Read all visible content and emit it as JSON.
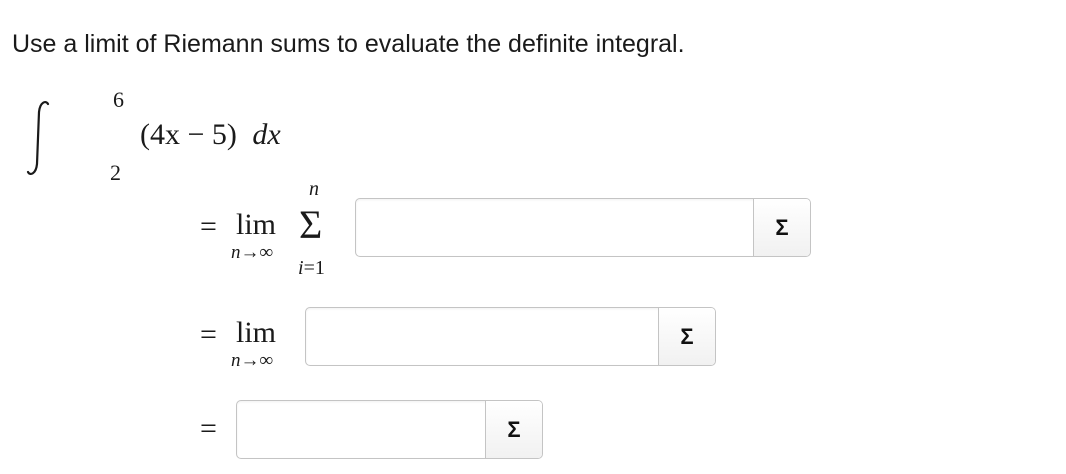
{
  "prompt": "Use a limit of Riemann sums to evaluate the definite integral.",
  "integral": {
    "upper": "6",
    "lower": "2",
    "integrand": "(4x − 5)",
    "differential": "dx"
  },
  "step1": {
    "equals": "=",
    "lim": "lim",
    "lim_sub": "n→∞",
    "sigma": "Σ",
    "sum_top": "n",
    "sum_bottom": "i=1",
    "input_value": "",
    "button_label": "Σ"
  },
  "step2": {
    "equals": "=",
    "lim": "lim",
    "lim_sub": "n→∞",
    "input_value": "",
    "button_label": "Σ"
  },
  "step3": {
    "equals": "=",
    "input_value": "",
    "button_label": "Σ"
  }
}
